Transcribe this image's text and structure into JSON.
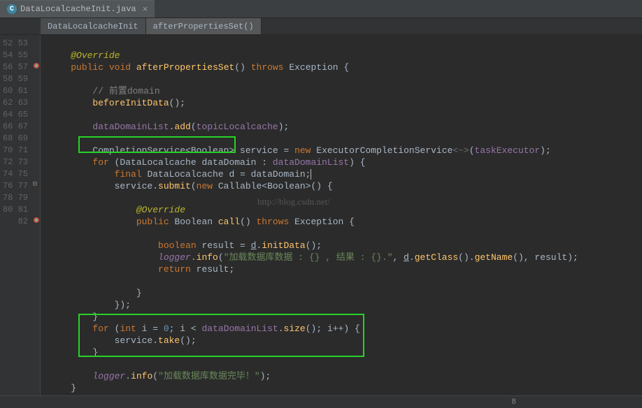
{
  "tab": {
    "icon_letter": "C",
    "filename": "DataLocalcacheInit.java",
    "close": "×"
  },
  "breadcrumbs": {
    "a": "DataLocalcacheInit",
    "b": "afterPropertiesSet()"
  },
  "lines": {
    "start": 52,
    "end": 82,
    "l52": "",
    "l53_ann": "@Override",
    "l54_kw1": "public",
    "l54_kw2": "void",
    "l54_m": "afterPropertiesSet",
    "l54_kw3": "throws",
    "l54_ex": "Exception",
    "l55": "",
    "l56_c": "// 前置domain",
    "l57_m": "beforeInitData",
    "l58": "",
    "l59_f": "dataDomainList",
    "l59_m": "add",
    "l59_a": "topicLocalcache",
    "l60": "",
    "l61_t1": "CompletionService",
    "l61_g": "Boolean",
    "l61_v": "service",
    "l61_kw": "new",
    "l61_t2": "ExecutorCompletionService",
    "l61_a": "taskExecutor",
    "l62_kw": "for",
    "l62_t": "DataLocalcache",
    "l62_v": "dataDomain",
    "l62_f": "dataDomainList",
    "l63_kw": "final",
    "l63_t": "DataLocalcache",
    "l63_v": "d",
    "l63_r": "dataDomain",
    "l64_o": "service",
    "l64_m": "submit",
    "l64_kw": "new",
    "l64_t": "Callable",
    "l64_g": "Boolean",
    "l65": "",
    "l66_ann": "@Override",
    "l67_kw1": "public",
    "l67_t": "Boolean",
    "l67_m": "call",
    "l67_kw2": "throws",
    "l67_ex": "Exception",
    "l68": "",
    "l69_kw": "boolean",
    "l69_v": "result",
    "l69_u": "d",
    "l69_m": "initData",
    "l70_o": "logger",
    "l70_m": "info",
    "l70_s": "\"加载数据库数据 : {} , 结果 : {}.\"",
    "l70_u": "d",
    "l70_c1": "getClass",
    "l70_c2": "getName",
    "l70_r": "result",
    "l71_kw": "return",
    "l71_v": "result",
    "l72": "",
    "l76_kw1": "for",
    "l76_kw2": "int",
    "l76_v": "i",
    "l76_n": "0",
    "l76_f": "dataDomainList",
    "l76_m": "size",
    "l77_o": "service",
    "l77_m": "take",
    "l80_o": "logger",
    "l80_m": "info",
    "l80_s": "\"加载数据库数据完毕！\""
  },
  "watermark": "http://blog.csdn.net/",
  "statusbar": "8"
}
